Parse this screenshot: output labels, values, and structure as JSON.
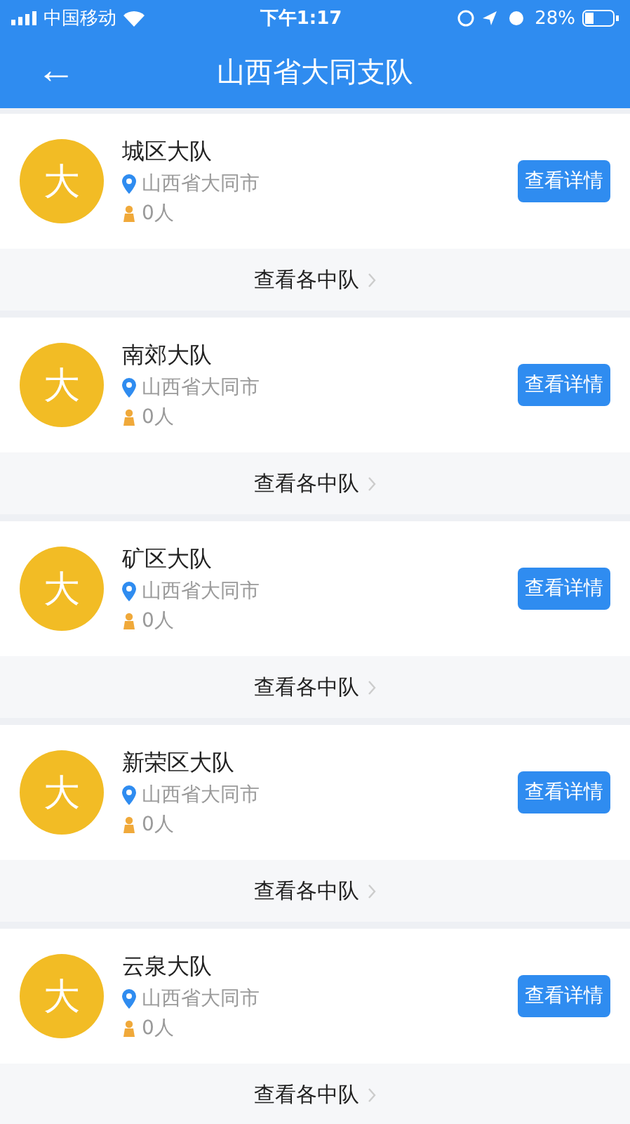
{
  "status_bar": {
    "carrier": "中国移动",
    "time": "下午1:17",
    "battery": "28%"
  },
  "header": {
    "back": "←",
    "title": "山西省大同支队"
  },
  "units": [
    {
      "avatar": "大",
      "name": "城区大队",
      "location": "山西省大同市",
      "members": "0人",
      "details_button": "查看详情",
      "squads_link": "查看各中队"
    },
    {
      "avatar": "大",
      "name": "南郊大队",
      "location": "山西省大同市",
      "members": "0人",
      "details_button": "查看详情",
      "squads_link": "查看各中队"
    },
    {
      "avatar": "大",
      "name": "矿区大队",
      "location": "山西省大同市",
      "members": "0人",
      "details_button": "查看详情",
      "squads_link": "查看各中队"
    },
    {
      "avatar": "大",
      "name": "新荣区大队",
      "location": "山西省大同市",
      "members": "0人",
      "details_button": "查看详情",
      "squads_link": "查看各中队"
    },
    {
      "avatar": "大",
      "name": "云泉大队",
      "location": "山西省大同市",
      "members": "0人",
      "details_button": "查看详情",
      "squads_link": "查看各中队"
    }
  ]
}
